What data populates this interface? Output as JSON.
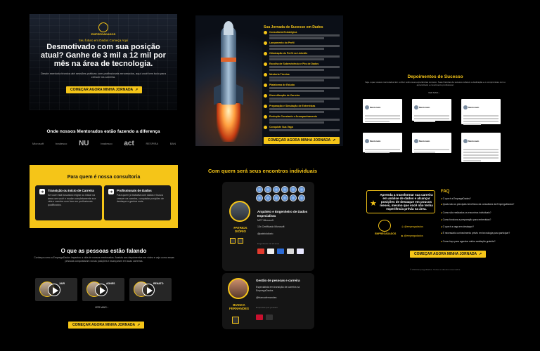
{
  "brand": {
    "name": "EMPREGADADOS",
    "handle_instagram": "@empregadados",
    "handle_youtube": "@empregadados"
  },
  "colors": {
    "accent": "#f5c518",
    "background": "#000000",
    "card": "#151515"
  },
  "hero": {
    "tagline": "Seu futuro em Dados Começa Aqui",
    "headline": "Desmotivado com sua posição atual? Ganhe de 3 mil a 12 mil por mês na área de tecnologia.",
    "subtext": "Desde mentoria técnica até sessões práticas com profissionais renomados, aqui você tem tudo para crescer na carreira.",
    "cta": "COMEÇAR AGORA MINHA JORNADA"
  },
  "mentorados": {
    "title": "Onde nossos Mentorados estão fazendo a diferença",
    "logos": [
      "Microsoft",
      "bradesco",
      "NU",
      "bradesco",
      "act",
      "RESPIRA",
      "BAN"
    ]
  },
  "para_quem": {
    "title": "Para quem é nossa consultoria",
    "cards": [
      {
        "title": "Transição ou Início de Carreira",
        "desc": "Se você está buscando migrar ou iniciar na área com você e mudar completamente sua vida e carreira com foco em profissionais qualificados."
      },
      {
        "title": "Profissionais de Dados",
        "desc": "Para quem já trabalha com dados e busca crescer na carreira, conquistar posições de destaque e ganhar mais."
      }
    ]
  },
  "depoimentos_video": {
    "title": "O que as pessoas estão falando",
    "subtitle": "Conheça como a EmpregaDados impactou a vida de nossos mentorados. Assista aos depoimentos em vídeo e veja como essas pessoas conquistaram novas posições e avançaram em suas carreiras.",
    "videos": [
      {
        "name": "JAIR"
      },
      {
        "name": "AGNES"
      },
      {
        "name": "RENATO"
      }
    ],
    "more": "VER MAIS",
    "cta": "COMEÇAR AGORA MINHA JORNADA"
  },
  "jornada": {
    "title": "Sua Jornada de Sucesso em Dados",
    "steps": [
      "Consultoria Estratégica",
      "Lançamento do Perfil",
      "Otimização do Perfil no LinkedIn",
      "Escolha de Sobrevivência e Pós de Dados",
      "Mentoria Técnica",
      "Plataforma de Estudo",
      "Diversificação de Carreira",
      "Preparação e Simulação de Entrevistas",
      "Evolução Constante e Acompanhamento",
      "Conquiste Sua Vaga"
    ],
    "cta": "COMEÇAR AGORA MINHA JORNADA"
  },
  "encontros": {
    "title": "Com quem será seus encontros individuais",
    "mentor1": {
      "name": "PATRICK DIÓRIO",
      "role": "Arquiteto e Engenheiro de Dados Especialista",
      "line1": "MCT Microsoft",
      "line2": "13x Certificado Microsoft",
      "line3": "@patrickdiorio",
      "line4": "Engenheiro há 10 anos"
    },
    "mentor2": {
      "name": "BIANCA FERNANDES",
      "role": "Gestão de pessoas e carreira",
      "desc": "Especialista em transição de carreira na EmpregaDados",
      "line1": "@biancafernandes",
      "line2": "Empresas que já atuou"
    }
  },
  "depoimentos_texto": {
    "title": "Depoimentos de Sucesso",
    "subtitle": "Veja o que nossos mentorados têm a dizer sobre suas experiências conosco. Suas histórias de sucesso refletem a dedicação e o compromisso com o aprendizado e crescimento profissional.",
    "more": "VER MAIS",
    "cards": [
      "Mentorado",
      "Mentorado",
      "Mentorado",
      "Mentorado",
      "Mentorado",
      "Mentorado"
    ]
  },
  "faq": {
    "promo": "Aprenda a transformar sua carreira em análise de dados e alcançar posições de destaque em poucos meses, mesmo que você não tenha experiência prévia na área.",
    "title": "FAQ",
    "questions": [
      "O que é a EmpregaDados?",
      "Quais são os principais benefícios da consultoria da EmpregaDados?",
      "Como são realizados os encontros individuais?",
      "Como funciona a preparação para entrevistas?",
      "O que é a vaga em destaque?",
      "É necessário conhecimento prévio em tecnologia para participar?",
      "Como faço para agendar minha avaliação gratuita?"
    ],
    "cta": "COMEÇAR AGORA MINHA JORNADA",
    "copyright": "© 2024 EmpregaDados. Todos os direitos reservados."
  }
}
